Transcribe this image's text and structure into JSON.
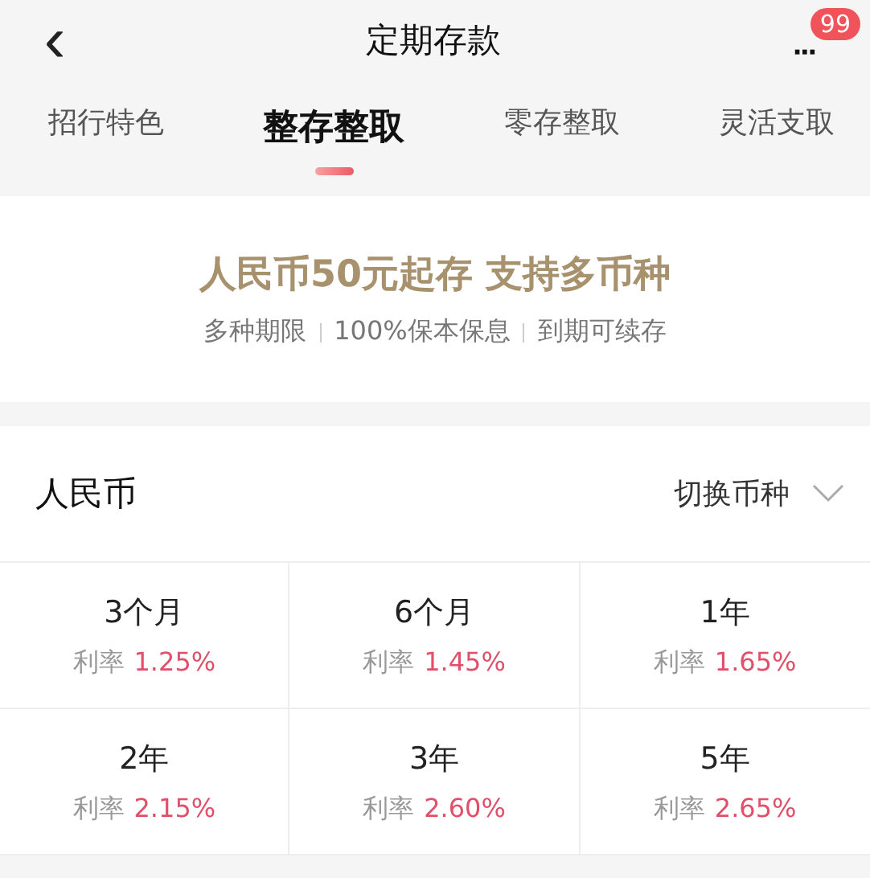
{
  "nav": {
    "back": "‹",
    "title": "定期存款",
    "more": "···",
    "badge": "99"
  },
  "tabs": [
    {
      "label": "招行特色",
      "selected": false
    },
    {
      "label": "整存整取",
      "selected": true
    },
    {
      "label": "零存整取",
      "selected": false
    },
    {
      "label": "灵活支取",
      "selected": false
    }
  ],
  "banner": {
    "headline": "人民币50元起存 支持多币种",
    "features": [
      "多种期限",
      "100%保本保息",
      "到期可续存"
    ]
  },
  "currency": {
    "name": "人民币",
    "switch": "切换币种",
    "expanded": false
  },
  "terms": [
    {
      "term": "3个月",
      "rate_label": "利率",
      "rate": "1.25%"
    },
    {
      "term": "6个月",
      "rate_label": "利率",
      "rate": "1.45%"
    },
    {
      "term": "1年",
      "rate_label": "利率",
      "rate": "1.65%"
    },
    {
      "term": "2年",
      "rate_label": "利率",
      "rate": "2.15%"
    },
    {
      "term": "3年",
      "rate_label": "利率",
      "rate": "2.60%"
    },
    {
      "term": "5年",
      "rate_label": "利率",
      "rate": "2.65%"
    }
  ]
}
